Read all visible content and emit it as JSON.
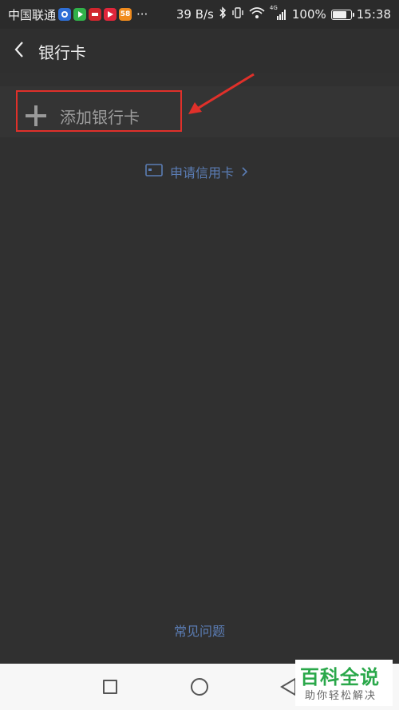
{
  "status_bar": {
    "carrier": "中国联通",
    "net_speed": "39 B/s",
    "signal_type": "4G",
    "battery_percent": "100%",
    "battery_level": 0.85,
    "time": "15:38",
    "app_icons": [
      {
        "name": "baidu-app-icon",
        "color": "#2f6fd6",
        "text": ""
      },
      {
        "name": "iqiyi-app-icon",
        "color": "#31b24a",
        "text": ""
      },
      {
        "name": "red-app-icon",
        "color": "#d0262d",
        "text": ""
      },
      {
        "name": "video-app-icon",
        "color": "#e0263b",
        "text": ""
      },
      {
        "name": "58-app-icon",
        "color": "#f08b1d",
        "text": "58"
      }
    ],
    "more_indicator": "···"
  },
  "header": {
    "title": "银行卡"
  },
  "add_card": {
    "label": "添加银行卡"
  },
  "apply_credit": {
    "label": "申请信用卡"
  },
  "footer": {
    "faq_label": "常见问题"
  },
  "watermark": {
    "title": "百科全说",
    "subtitle": "助你轻松解决"
  },
  "colors": {
    "background": "#303030",
    "link": "#5b7db5",
    "highlight": "#e0302a",
    "watermark_green": "#2aa84a"
  }
}
